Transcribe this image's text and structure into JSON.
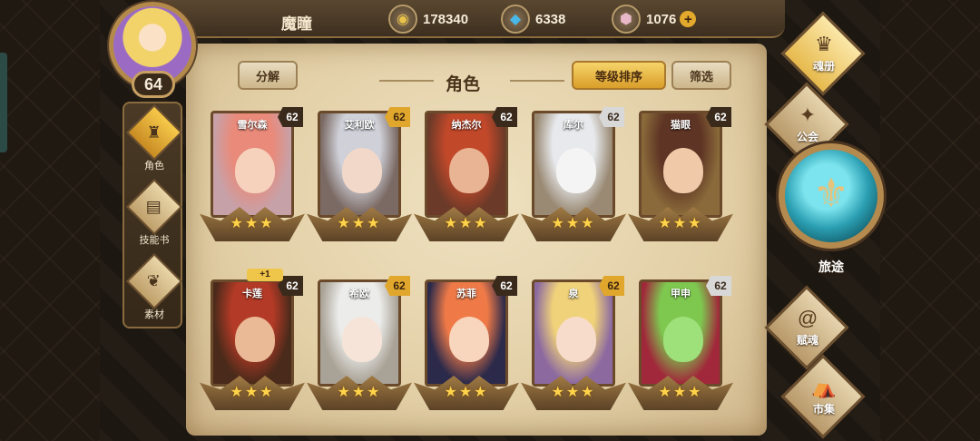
{
  "player": {
    "name": "魔瞳",
    "level": "64"
  },
  "resources": {
    "gold": "178340",
    "crystal": "6338",
    "gem": "1076",
    "add_symbol": "+"
  },
  "left_menu": [
    {
      "label": "角色",
      "icon": "helmet-icon",
      "active": true
    },
    {
      "label": "技能书",
      "icon": "skill-book-icon",
      "active": false
    },
    {
      "label": "素材",
      "icon": "material-icon",
      "active": false
    }
  ],
  "header": {
    "decompose_label": "分解",
    "title": "角色",
    "sort_label": "等级排序",
    "filter_label": "筛选"
  },
  "heroes": [
    {
      "name": "雪尔森",
      "level": "62",
      "badge": "dark",
      "hair": "#e98a7a",
      "face": "#f6d2bd",
      "bg": "#c7a1a8"
    },
    {
      "name": "艾利欧",
      "level": "62",
      "badge": "gold",
      "hair": "#cfd0d8",
      "face": "#f2d8c8",
      "bg": "#7b6a64"
    },
    {
      "name": "纳杰尔",
      "level": "62",
      "badge": "dark",
      "hair": "#c2482a",
      "face": "#e8b493",
      "bg": "#6b3a28"
    },
    {
      "name": "库尔",
      "level": "62",
      "badge": "silver",
      "hair": "#e7e9ec",
      "face": "#f4f4f4",
      "bg": "#9a8a74"
    },
    {
      "name": "猫眼",
      "level": "62",
      "badge": "dark",
      "hair": "#5e3424",
      "face": "#f0c9a8",
      "bg": "#8a6a3a"
    },
    {
      "name": "卡莲",
      "level": "62",
      "badge": "dark",
      "hair": "#b33a26",
      "face": "#eab996",
      "bg": "#4a2a1a",
      "plus": "+1"
    },
    {
      "name": "希欧",
      "level": "62",
      "badge": "gold",
      "hair": "#ececea",
      "face": "#f6e4d8",
      "bg": "#a9a296"
    },
    {
      "name": "苏菲",
      "level": "62",
      "badge": "dark",
      "hair": "#ef7a48",
      "face": "#f8d6bd",
      "bg": "#2c2a4a"
    },
    {
      "name": "泉",
      "level": "62",
      "badge": "gold",
      "hair": "#f0d27a",
      "face": "#f7dccb",
      "bg": "#8c6aa0"
    },
    {
      "name": "甲申",
      "level": "62",
      "badge": "silver",
      "hair": "#7ec850",
      "face": "#9ee07a",
      "bg": "#a0283a"
    }
  ],
  "right_menu": [
    {
      "label": "魂册",
      "icon": "soul-book-icon",
      "active": true
    },
    {
      "label": "公会",
      "icon": "guild-icon",
      "active": false
    },
    {
      "label": "赋魂",
      "icon": "enchant-icon",
      "active": false
    },
    {
      "label": "市集",
      "icon": "market-icon",
      "active": false
    }
  ],
  "journey": {
    "label": "旅途",
    "icon": "journey-emblem-icon"
  },
  "stars_per_hero": "3"
}
